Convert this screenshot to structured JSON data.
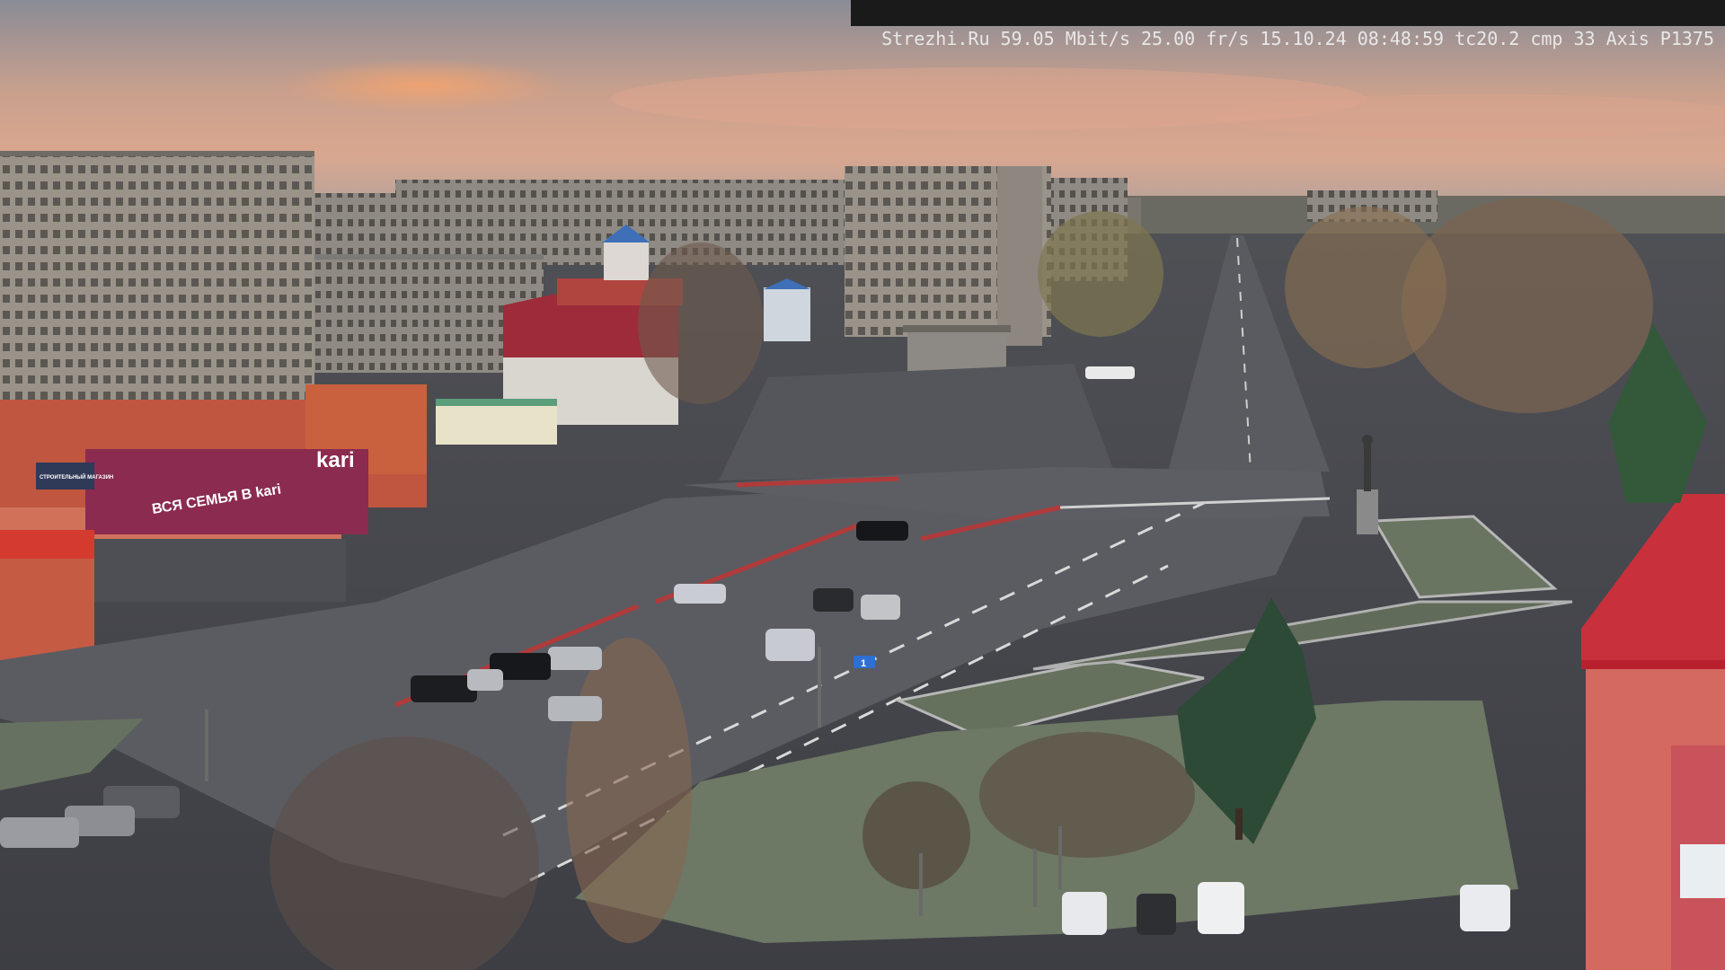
{
  "overlay": {
    "site": "Strezhi.Ru",
    "bitrate": "59.05 Mbit/s",
    "framerate": "25.00 fr/s",
    "date": "15.10.24",
    "time": "08:48:59",
    "tc": "tc20.2",
    "cmp": "cmp 33",
    "camera": "Axis P1375"
  },
  "signs": {
    "kari_logo": "kari",
    "kari_banner": "ВСЯ СЕМЬЯ В kari",
    "left_building_sign": "СТРОИТЕЛЬНЫЙ МАГАЗИН",
    "street_sign": "1"
  },
  "colors": {
    "sky_top": "#8a8f99",
    "sky_glow": "#e9a27c",
    "road": "#5b5c62",
    "kari_red": "#a0304f",
    "building_grey": "#9c958c",
    "grass": "#6e7a64"
  }
}
